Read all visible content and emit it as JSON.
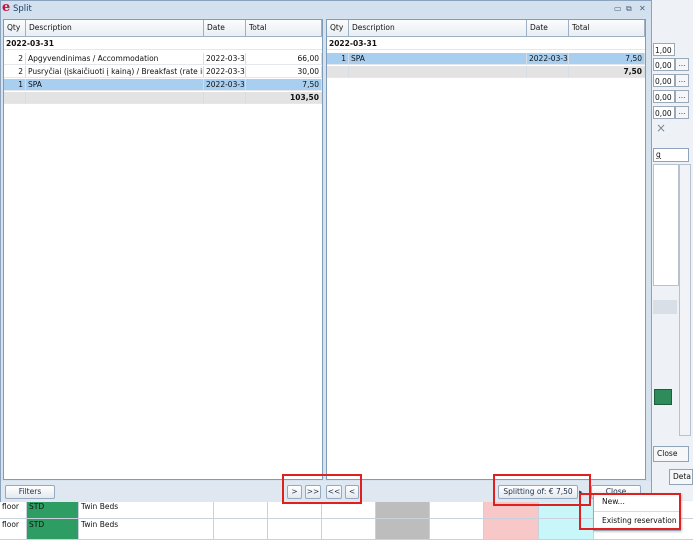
{
  "window": {
    "title": "Split"
  },
  "left_table": {
    "columns": [
      "Qty",
      "Description",
      "Date",
      "Total"
    ],
    "group": "2022-03-31",
    "rows": [
      {
        "qty": "2",
        "desc": "Apgyvendinimas / Accommodation",
        "date": "2022-03-3",
        "total": "66,00"
      },
      {
        "qty": "2",
        "desc": "Pusryčiai (įskaičiuoti į kainą) / Breakfast (rate in",
        "date": "2022-03-3",
        "total": "30,00"
      },
      {
        "qty": "1",
        "desc": "SPA",
        "date": "2022-03-3",
        "total": "7,50"
      }
    ],
    "sum": "103,50"
  },
  "right_table": {
    "columns": [
      "Qty",
      "Description",
      "Date",
      "Total"
    ],
    "group": "2022-03-31",
    "rows": [
      {
        "qty": "1",
        "desc": "SPA",
        "date": "2022-03-3",
        "total": "7,50"
      }
    ],
    "sum": "7,50"
  },
  "buttons": {
    "filters": "Filters",
    "move_right": ">",
    "move_all_right": ">>",
    "move_all_left": "<<",
    "move_left": "<",
    "splitting": "Splitting of: € 7,50",
    "close": "Close"
  },
  "popup": {
    "items": [
      "New...",
      "Existing reservation"
    ]
  },
  "background": {
    "values": [
      "1,00",
      "0,00",
      "0,00",
      "0,00",
      "0,00"
    ],
    "dots": "...",
    "tab_label": "g",
    "close": "Close",
    "details": "Deta",
    "x_mark": "×",
    "grid_rows": [
      {
        "floor": "floor",
        "type": "STD",
        "beds": "Twin Beds"
      },
      {
        "floor": "floor",
        "type": "STD",
        "beds": "Twin Beds"
      }
    ]
  },
  "colors": {
    "accent": "#a9cff0",
    "std_cell": "#2e9d63",
    "pink_cell": "#f8c8c8",
    "cyan_cell": "#c9f6f8",
    "highlight_border": "#e0201f"
  }
}
